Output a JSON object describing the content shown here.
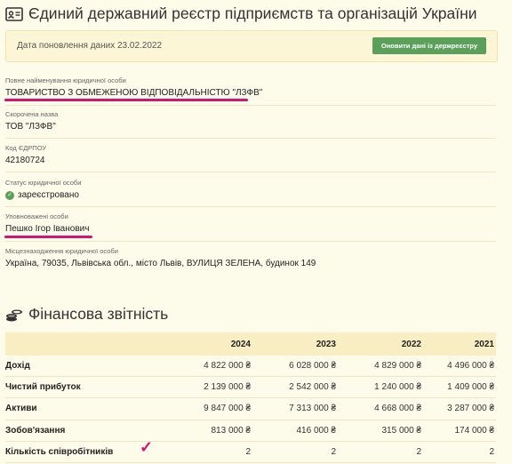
{
  "registry": {
    "title": "Єдиний державний реєстр підприємств та організацій України",
    "update_text": "Дата поновлення даних 23.02.2022",
    "update_button": "Оновити дані із держреєстру",
    "fields": [
      {
        "label": "Повне найменування юридичної особи",
        "value": "ТОВАРИСТВО З ОБМЕЖЕНОЮ ВІДПОВІДАЛЬНІСТЮ \"ЛЗФВ\""
      },
      {
        "label": "Скорочена назва",
        "value": "ТОВ \"ЛЗФВ\""
      },
      {
        "label": "Код ЄДРПОУ",
        "value": "42180724"
      },
      {
        "label": "Статус юридичної особи",
        "value": "зареєстровано"
      },
      {
        "label": "Уповноважені особи",
        "value": "Пешко Ігор Іванович"
      },
      {
        "label": "Місцезнаходження юридичної особи",
        "value": "Україна, 79035, Львівська обл., місто Львів, ВУЛИЦЯ ЗЕЛЕНА, будинок 149"
      }
    ]
  },
  "financial": {
    "title": "Фінансова звітність",
    "years": [
      "2024",
      "2023",
      "2022",
      "2021"
    ],
    "rows": [
      {
        "label": "Дохід",
        "values": [
          "4 822 000 ₴",
          "6 028 000 ₴",
          "4 829 000 ₴",
          "4 496 000 ₴"
        ]
      },
      {
        "label": "Чистий прибуток",
        "values": [
          "2 139 000 ₴",
          "2 542 000 ₴",
          "1 240 000 ₴",
          "1 409 000 ₴"
        ]
      },
      {
        "label": "Активи",
        "values": [
          "9 847 000 ₴",
          "7 313 000 ₴",
          "4 668 000 ₴",
          "3 287 000 ₴"
        ]
      },
      {
        "label": "Зобов'язання",
        "values": [
          "813 000 ₴",
          "416 000 ₴",
          "315 000 ₴",
          "174 000 ₴"
        ]
      },
      {
        "label": "Кількість співробітників",
        "values": [
          "2",
          "2",
          "2",
          "2"
        ]
      }
    ]
  },
  "colors": {
    "accent_green": "#5ba05a",
    "annotation_magenta": "#d4146e",
    "background": "#fdfbea"
  },
  "icons": {
    "registry": "id-card-icon",
    "financial": "coins-stack-icon",
    "status": "check-circle-icon",
    "annotation": "checkmark-annotation"
  }
}
